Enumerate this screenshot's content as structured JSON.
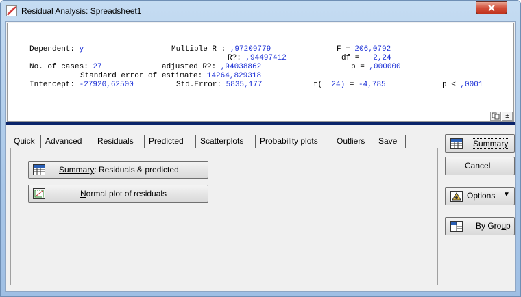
{
  "window": {
    "title": "Residual Analysis: Spreadsheet1",
    "icon": "residual-analysis-icon",
    "close_icon": "close-x-icon",
    "titlebar_color": "#b3cfee",
    "close_color": "#c8432c"
  },
  "results": {
    "dependent_label": "Dependent:",
    "dependent_value": "y",
    "multiple_r_label": "Multiple R :",
    "multiple_r_value": ",97209779",
    "f_label": "F =",
    "f_value": "206,0792",
    "r2_label": "R?:",
    "r2_value": ",94497412",
    "df_label": "df =",
    "df_value": "2,24",
    "cases_label": "No. of cases:",
    "cases_value": "27",
    "adj_r2_label": "adjusted R?:",
    "adj_r2_value": ",94038862",
    "p_label": "p =",
    "p_value": ",000000",
    "se_label": "Standard error of estimate:",
    "se_value": "14264,829318",
    "intercept_label": "Intercept:",
    "intercept_value": "-27920,62500",
    "stderr_label": "Std.Error:",
    "stderr_value": "5835,177",
    "t_label": "t(",
    "t_df": "24)",
    "t_eq": "=",
    "t_value": "-4,785",
    "plt_label": "p <",
    "plt_value": ",0001",
    "copy_icon": "copy-icon",
    "toggle_label": "±",
    "value_color": "#1a2fd6"
  },
  "tabs": [
    "Quick",
    "Advanced",
    "Residuals",
    "Predicted",
    "Scatterplots",
    "Probability plots",
    "Outliers",
    "Save"
  ],
  "quick": {
    "summary_btn_pre": "Summary",
    "summary_btn_post": ":  Residuals & predicted",
    "summary_icon": "summary-table-icon",
    "normal_plot_first": "N",
    "normal_plot_rest": "ormal plot of residuals",
    "normal_plot_icon": "normal-plot-icon"
  },
  "side": {
    "summary_label": "Summary",
    "summary_icon": "summary-table-icon",
    "cancel_label": "Cancel",
    "options_label": "Options",
    "options_icon": "options-icon",
    "options_arrow": "▼",
    "bygroup_pre": "By Gro",
    "bygroup_u": "u",
    "bygroup_post": "p",
    "bygroup_icon": "by-group-icon"
  }
}
